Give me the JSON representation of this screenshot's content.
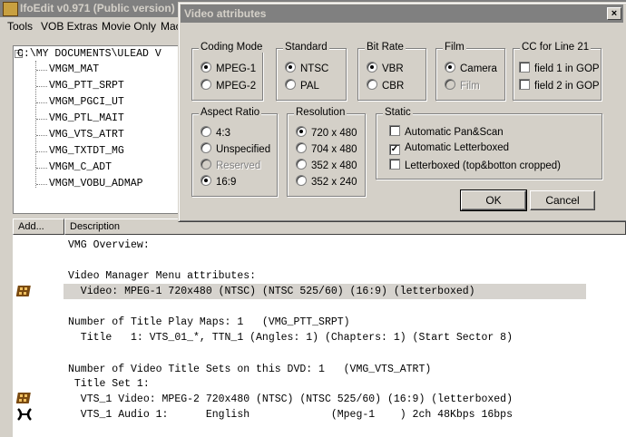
{
  "app": {
    "title": "IfoEdit v0.971 (Public version)"
  },
  "menu": [
    "Tools",
    "VOB Extras",
    "Movie Only",
    "Mac"
  ],
  "tree": {
    "root": "C:\\MY DOCUMENTS\\ULEAD V",
    "nodes": [
      "VMGM_MAT",
      "VMG_PTT_SRPT",
      "VMGM_PGCI_UT",
      "VMG_PTL_MAIT",
      "VMG_VTS_ATRT",
      "VMG_TXTDT_MG",
      "VMGM_C_ADT",
      "VMGM_VOBU_ADMAP"
    ]
  },
  "list": {
    "headers": [
      "Add...",
      "Description"
    ],
    "lines": [
      "VMG Overview:",
      "",
      "Video Manager Menu attributes:",
      "  Video: MPEG-1 720x480 (NTSC) (NTSC 525/60) (16:9) (letterboxed)",
      "",
      "Number of Title Play Maps: 1   (VMG_PTT_SRPT)",
      "  Title   1: VTS_01_*, TTN_1 (Angles: 1) (Chapters: 1) (Start Sector 8)",
      "",
      "Number of Video Title Sets on this DVD: 1   (VMG_VTS_ATRT)",
      " Title Set 1:",
      "  VTS_1 Video: MPEG-2 720x480 (NTSC) (NTSC 525/60) (16:9) (letterboxed)",
      "  VTS_1 Audio 1:      English             (Mpeg-1    ) 2ch 48Kbps 16bps"
    ]
  },
  "dialog": {
    "title": "Video attributes",
    "close": "×",
    "coding_mode": {
      "label": "Coding Mode",
      "options": [
        "MPEG-1",
        "MPEG-2"
      ],
      "selected": "MPEG-1"
    },
    "standard": {
      "label": "Standard",
      "options": [
        "NTSC",
        "PAL"
      ],
      "selected": "NTSC"
    },
    "bit_rate": {
      "label": "Bit Rate",
      "options": [
        "VBR",
        "CBR"
      ],
      "selected": "VBR"
    },
    "film": {
      "label": "Film",
      "options": [
        "Camera",
        "Film"
      ],
      "selected": "Camera",
      "disabled": [
        "Film"
      ]
    },
    "cc": {
      "label": "CC for Line 21",
      "options": [
        "field 1 in GOP",
        "field 2 in GOP"
      ],
      "checked": []
    },
    "aspect_ratio": {
      "label": "Aspect Ratio",
      "options": [
        "4:3",
        "Unspecified",
        "Reserved",
        "16:9"
      ],
      "selected": "16:9",
      "disabled": [
        "Reserved"
      ]
    },
    "resolution": {
      "label": "Resolution",
      "options": [
        "720 x 480",
        "704 x 480",
        "352 x 480",
        "352 x 240"
      ],
      "selected": "720 x 480"
    },
    "static": {
      "label": "Static",
      "options": [
        "Automatic Pan&Scan",
        "Automatic Letterboxed",
        "Letterboxed (top&botton cropped)"
      ],
      "checked": [
        "Automatic Letterboxed"
      ]
    },
    "ok": "OK",
    "cancel": "Cancel"
  }
}
